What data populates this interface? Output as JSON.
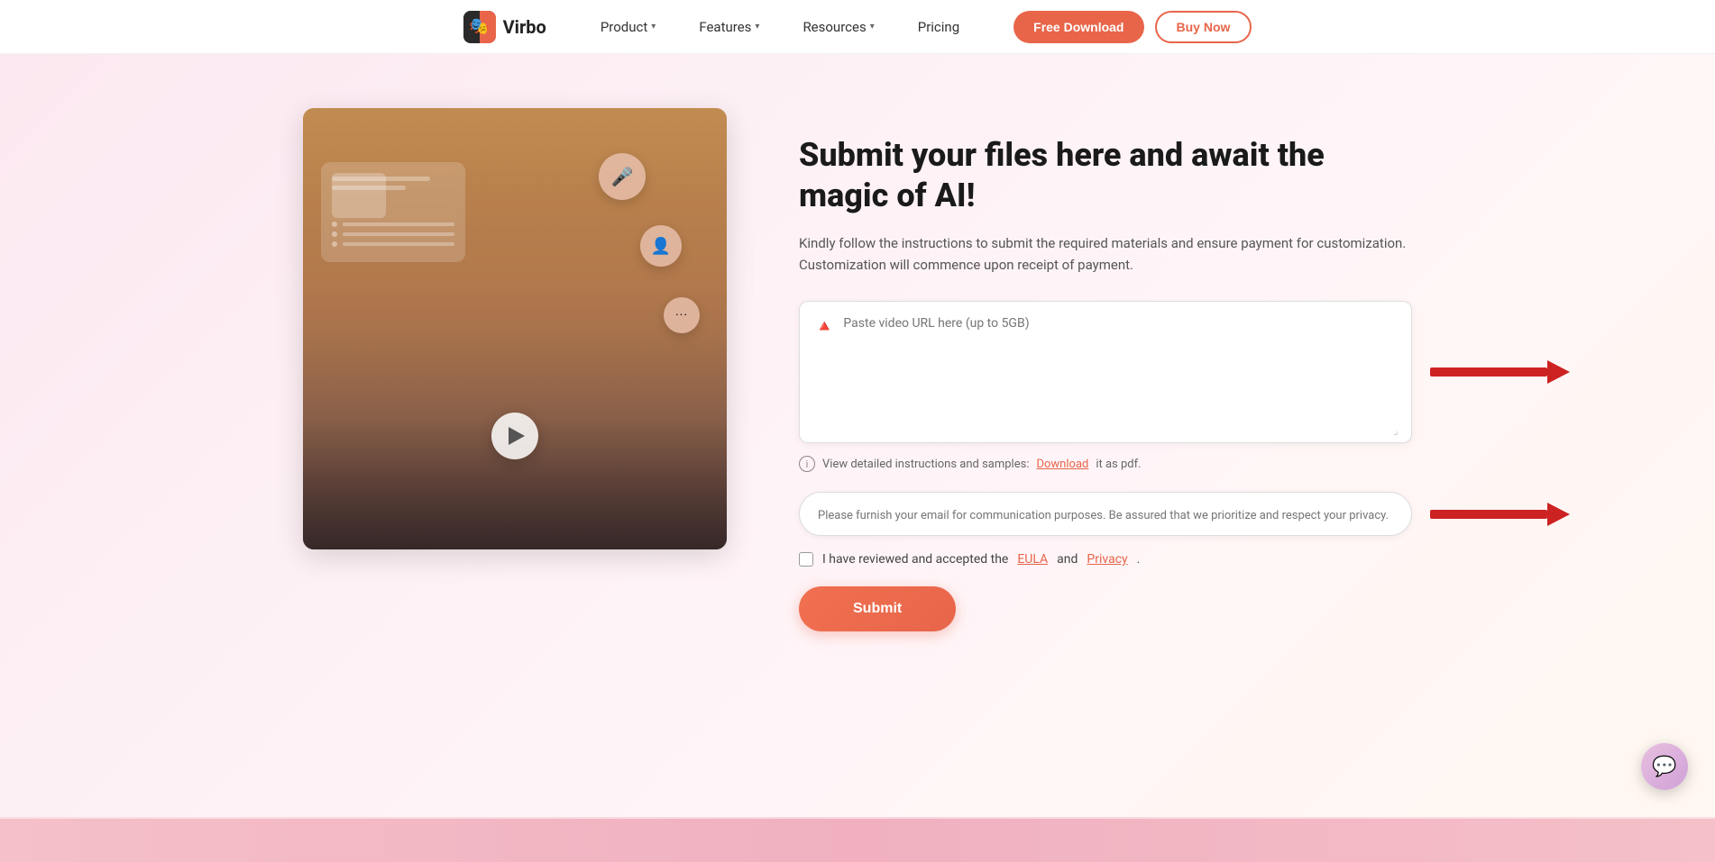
{
  "navbar": {
    "logo_text": "Virbo",
    "logo_emoji": "🎭",
    "nav_items": [
      {
        "label": "Product",
        "has_chevron": true
      },
      {
        "label": "Features",
        "has_chevron": true
      },
      {
        "label": "Resources",
        "has_chevron": true
      },
      {
        "label": "Pricing",
        "has_chevron": false
      }
    ],
    "btn_free_download": "Free Download",
    "btn_buy_now": "Buy Now"
  },
  "hero": {
    "title": "Submit your files here and await the magic of AI!",
    "subtitle": "Kindly follow the instructions to submit the required materials and ensure payment for customization. Customization will commence upon receipt of payment.",
    "url_input_placeholder": "Paste video URL here (up to 5GB)",
    "info_text": "View detailed instructions and samples:",
    "info_download_label": "Download",
    "info_suffix": "it as pdf.",
    "email_placeholder": "Please furnish your email for communication purposes. Be assured that we prioritize and respect your privacy.",
    "checkbox_label": "I have reviewed and accepted the ",
    "eula_label": "EULA",
    "and_text": " and ",
    "privacy_label": "Privacy",
    "checkbox_suffix": ".",
    "submit_label": "Submit"
  },
  "chat_bubble": {
    "icon": "💬"
  }
}
